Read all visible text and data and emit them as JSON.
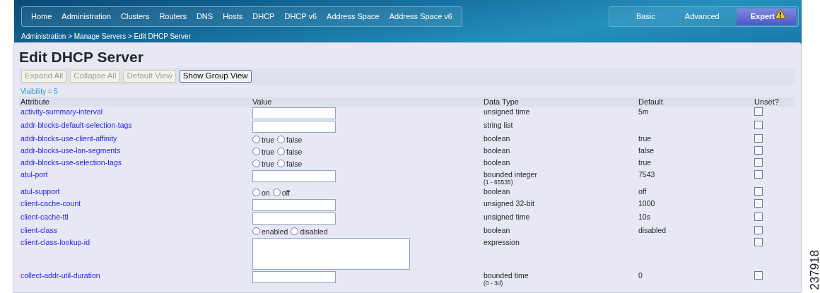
{
  "nav": [
    {
      "label": "Home"
    },
    {
      "label": "Administration"
    },
    {
      "label": "Clusters"
    },
    {
      "label": "Routers"
    },
    {
      "label": "DNS"
    },
    {
      "label": "Hosts"
    },
    {
      "label": "DHCP"
    },
    {
      "label": "DHCP v6"
    },
    {
      "label": "Address Space"
    },
    {
      "label": "Address Space v6"
    }
  ],
  "modes": [
    {
      "label": "Basic",
      "selected": false
    },
    {
      "label": "Advanced",
      "selected": false
    },
    {
      "label": "Expert",
      "selected": true,
      "warning": true
    }
  ],
  "breadcrumb": "Administration > Manage Servers > Edit DHCP Server",
  "title": "Edit DHCP Server",
  "toolbar": [
    {
      "label": "Expand All",
      "disabled": true
    },
    {
      "label": "Collapse All",
      "disabled": true
    },
    {
      "label": "Default View",
      "disabled": true
    },
    {
      "label": "Show Group View",
      "disabled": false
    }
  ],
  "visibility": "Visibility = 5",
  "columns": [
    "Attribute",
    "Value",
    "Data Type",
    "Default",
    "Unset?"
  ],
  "rows": [
    {
      "attribute": "activity-summary-interval",
      "kind": "text",
      "data_type": "unsigned time",
      "default": "5m",
      "unset": false
    },
    {
      "attribute": "addr-blocks-default-selection-tags",
      "kind": "text",
      "data_type": "string list",
      "unset": false
    },
    {
      "attribute": "addr-blocks-use-client-affinity",
      "kind": "radio",
      "options": [
        {
          "label": "true",
          "selected": false
        },
        {
          "label": "false",
          "selected": false
        }
      ],
      "data_type": "boolean",
      "default": "true",
      "unset": false
    },
    {
      "attribute": "addr-blocks-use-lan-segments",
      "kind": "radio",
      "options": [
        {
          "label": "true",
          "selected": false
        },
        {
          "label": "false",
          "selected": false
        }
      ],
      "data_type": "boolean",
      "default": "false",
      "unset": false
    },
    {
      "attribute": "addr-blocks-use-selection-tags",
      "kind": "radio",
      "options": [
        {
          "label": "true",
          "selected": false
        },
        {
          "label": "false",
          "selected": false
        }
      ],
      "data_type": "boolean",
      "default": "true",
      "unset": false
    },
    {
      "attribute": "atul-port",
      "kind": "text",
      "data_type": "bounded integer",
      "range": "(1 - 65535)",
      "default": "7543",
      "unset": false
    },
    {
      "attribute": "atul-support",
      "kind": "radio",
      "options": [
        {
          "label": "on",
          "selected": false
        },
        {
          "label": "off",
          "selected": false
        }
      ],
      "data_type": "boolean",
      "default": "off",
      "unset": false
    },
    {
      "attribute": "client-cache-count",
      "kind": "text",
      "data_type": "unsigned 32-bit",
      "default": "1000",
      "unset": false
    },
    {
      "attribute": "client-cache-ttl",
      "kind": "text",
      "data_type": "unsigned time",
      "default": "10s",
      "unset": false
    },
    {
      "attribute": "client-class",
      "kind": "radio",
      "options": [
        {
          "label": "enabled",
          "selected": false
        },
        {
          "label": "disabled",
          "selected": false
        }
      ],
      "data_type": "boolean",
      "default": "disabled",
      "unset": false
    },
    {
      "attribute": "client-class-lookup-id",
      "kind": "textarea",
      "data_type": "expression",
      "unset": false
    },
    {
      "attribute": "collect-addr-util-duration",
      "kind": "text",
      "data_type": "bounded time",
      "range": "(0 - 3d)",
      "default": "0",
      "unset": false
    }
  ],
  "figure_id": "237918"
}
